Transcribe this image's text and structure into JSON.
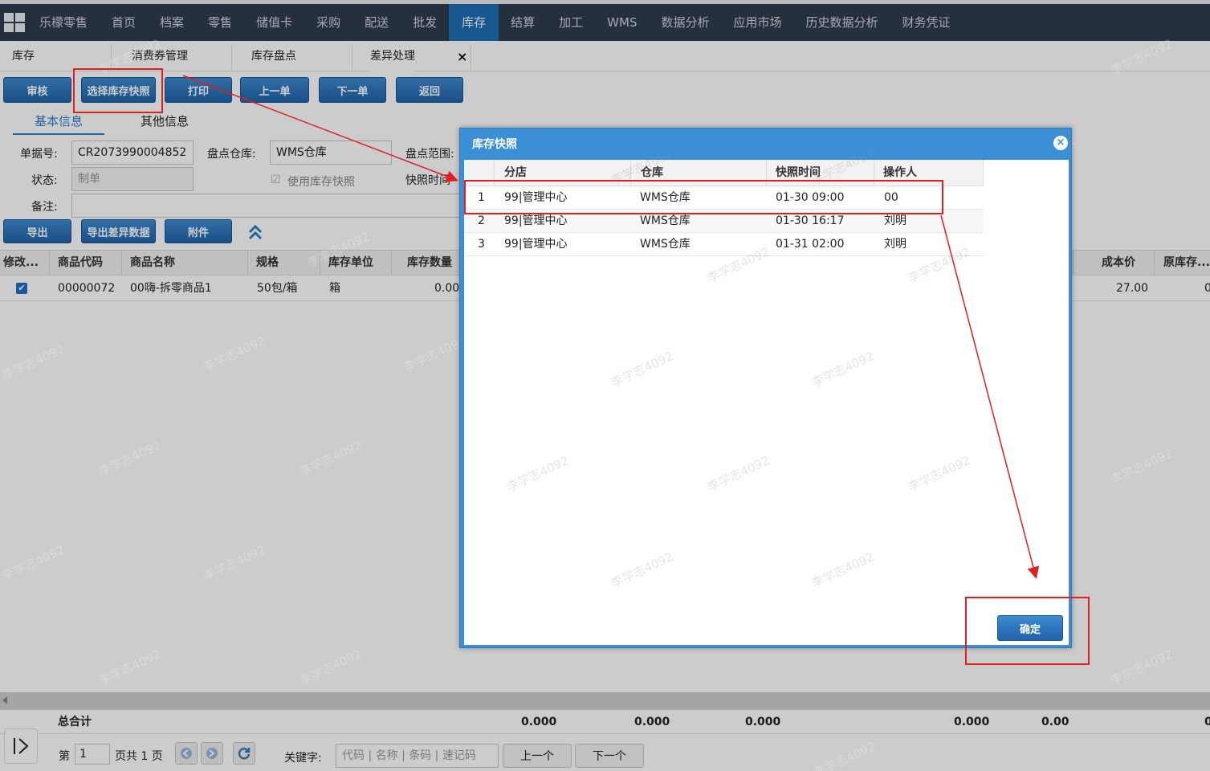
{
  "nav": {
    "items": [
      "乐檬零售",
      "首页",
      "档案",
      "零售",
      "储值卡",
      "采购",
      "配送",
      "批发",
      "库存",
      "结算",
      "加工",
      "WMS",
      "数据分析",
      "应用市场",
      "历史数据分析",
      "财务凭证"
    ],
    "active_index": 8
  },
  "tabs": {
    "module": "库存",
    "items": [
      "消费券管理",
      "库存盘点",
      "差异处理"
    ],
    "close": "×"
  },
  "toolbar": {
    "audit": "审核",
    "select_snapshot": "选择库存快照",
    "print": "打印",
    "prev": "上一单",
    "next": "下一单",
    "back": "返回"
  },
  "subtabs": {
    "basic": "基本信息",
    "other": "其他信息"
  },
  "form": {
    "doc_no_label": "单据号:",
    "doc_no": "CR2073990004852",
    "warehouse_label": "盘点仓库:",
    "warehouse": "WMS仓库",
    "range_label": "盘点范围:",
    "status_label": "状态:",
    "status": "制单",
    "use_snapshot": "使用库存快照",
    "snapshot_time_label": "快照时间",
    "remark_label": "备注:"
  },
  "actions": {
    "export": "导出",
    "export_diff": "导出差异数据",
    "attachment": "附件"
  },
  "grid": {
    "columns": [
      "修改...",
      "商品代码",
      "商品名称",
      "规格",
      "库存单位",
      "库存数量",
      "成本价",
      "原库存..."
    ],
    "rows": [
      {
        "checked": true,
        "code": "00000072",
        "name": "00嗨-拆零商品1",
        "spec": "50包/箱",
        "unit": "箱",
        "qty": "0.00",
        "cost": "27.00",
        "orig": "0"
      }
    ]
  },
  "totals": {
    "label": "总合计",
    "values": [
      "0.000",
      "0.000",
      "0.000",
      "0.000",
      "0.00",
      "0"
    ]
  },
  "pager": {
    "page_prefix": "第",
    "page_value": "1",
    "page_suffix": "页共 1 页",
    "keyword_label": "关键字:",
    "keyword_placeholder": "代码 | 名称 | 条码 | 速记码",
    "prev": "上一个",
    "next": "下一个"
  },
  "dialog": {
    "title": "库存快照",
    "columns": [
      "分店",
      "仓库",
      "快照时间",
      "操作人"
    ],
    "rows": [
      {
        "no": "1",
        "store": "99|管理中心",
        "warehouse": "WMS仓库",
        "time": "01-30 09:00",
        "operator": "00"
      },
      {
        "no": "2",
        "store": "99|管理中心",
        "warehouse": "WMS仓库",
        "time": "01-30 16:17",
        "operator": "刘明"
      },
      {
        "no": "3",
        "store": "99|管理中心",
        "warehouse": "WMS仓库",
        "time": "01-31 02:00",
        "operator": "刘明"
      }
    ],
    "confirm": "确定"
  },
  "watermark": "李学志4092"
}
